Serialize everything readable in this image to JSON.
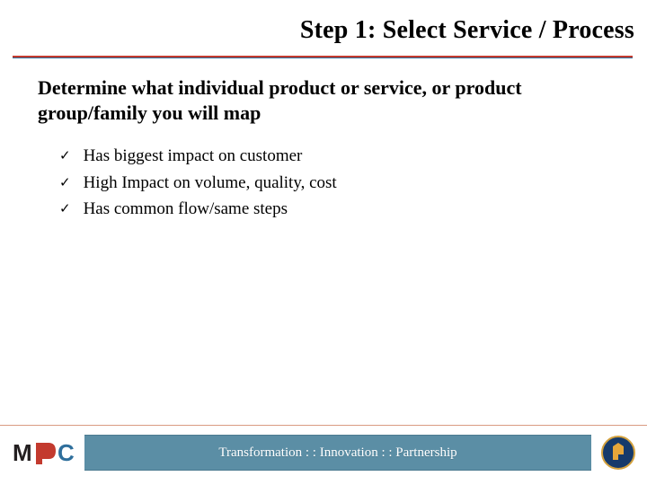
{
  "title": {
    "step": "Step 1",
    "sep": ": ",
    "rest": "Select Service / Process"
  },
  "subhead": "Determine what individual product or service, or product group/family you will map",
  "bullets": [
    "Has biggest impact on customer",
    "High Impact on volume, quality, cost",
    "Has common flow/same steps"
  ],
  "footer": {
    "tagline": "Transformation : : Innovation : : Partnership"
  },
  "icons": {
    "check": "✓"
  },
  "colors": {
    "accent_red": "#c33a2e",
    "accent_blue": "#2f6f9c",
    "band": "#5b8ea5"
  }
}
